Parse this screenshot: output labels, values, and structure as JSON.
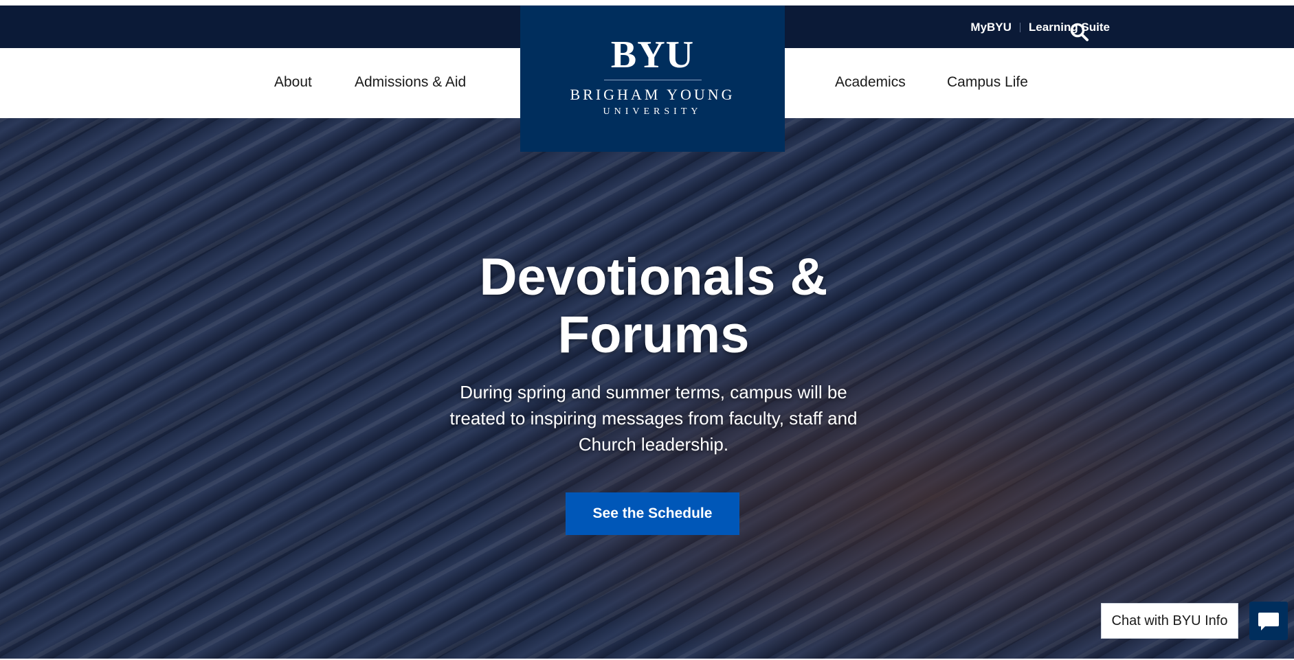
{
  "utility_nav": {
    "links": [
      "MyBYU",
      "Learning Suite"
    ],
    "search_icon": "search-icon"
  },
  "main_nav": {
    "left": [
      "About",
      "Admissions & Aid"
    ],
    "right": [
      "Academics",
      "Campus Life"
    ]
  },
  "logo": {
    "mark": "BYU",
    "line1": "BRIGHAM YOUNG",
    "line2": "UNIVERSITY"
  },
  "hero": {
    "title": "Devotionals & Forums",
    "subtitle": "During spring and summer terms, campus will be treated to inspiring messages from faculty, staff and Church leadership.",
    "cta": "See the Schedule"
  },
  "chat": {
    "label": "Chat with BYU Info",
    "icon": "chat-bubble-icon"
  },
  "colors": {
    "top_bar": "#0b1a37",
    "logo_bg": "#002e5d",
    "cta_bg": "#0057b8"
  }
}
